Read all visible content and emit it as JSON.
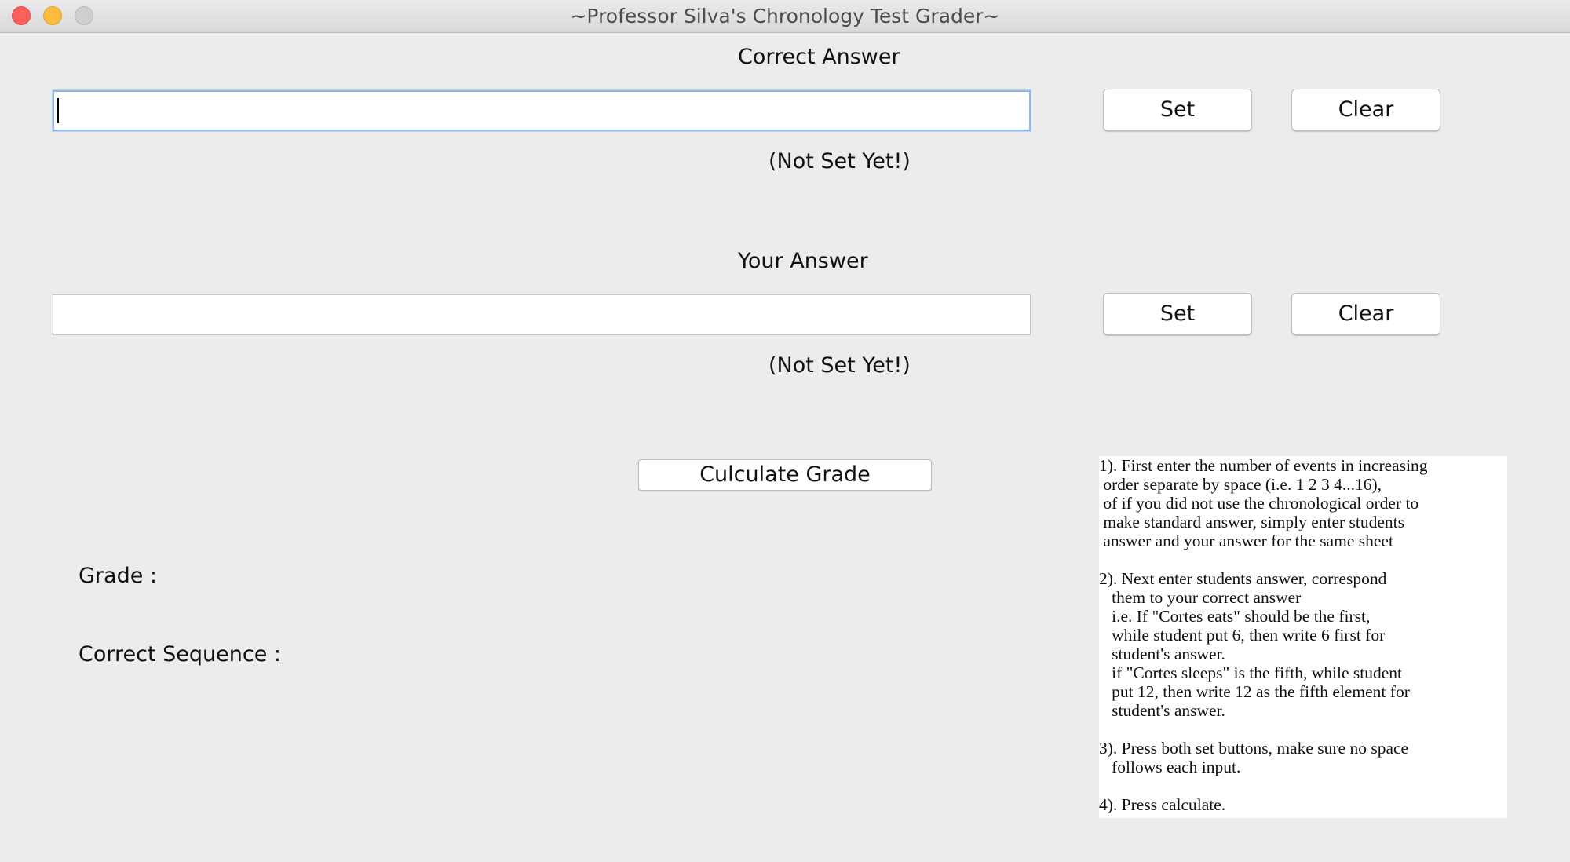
{
  "window": {
    "title": "~Professor Silva's Chronology Test Grader~"
  },
  "correct_answer": {
    "heading": "Correct Answer",
    "input_value": "",
    "set_label": "Set",
    "clear_label": "Clear",
    "status": "(Not Set Yet!)"
  },
  "your_answer": {
    "heading": "Your Answer",
    "input_value": "",
    "set_label": "Set",
    "clear_label": "Clear",
    "status": "(Not Set Yet!)"
  },
  "calculate": {
    "label": "Culculate Grade"
  },
  "results": {
    "grade_label": "Grade :",
    "sequence_label": "Correct Sequence :"
  },
  "instructions": {
    "lines": [
      "1). First enter the number of events in increasing",
      " order separate by space (i.e. 1 2 3 4...16),",
      " of if you did not use the chronological order to",
      " make standard answer, simply enter students",
      " answer and your answer for the same sheet",
      "",
      "2). Next enter students answer, correspond",
      "   them to your correct answer",
      "   i.e. If \"Cortes eats\" should be the first,",
      "   while student put 6, then write 6 first for",
      "   student's answer.",
      "   if \"Cortes sleeps\" is the fifth, while student",
      "   put 12, then write 12 as the fifth element for",
      "   student's answer.",
      "",
      "3). Press both set buttons, make sure no space",
      "   follows each input.",
      "",
      "4). Press calculate."
    ]
  }
}
